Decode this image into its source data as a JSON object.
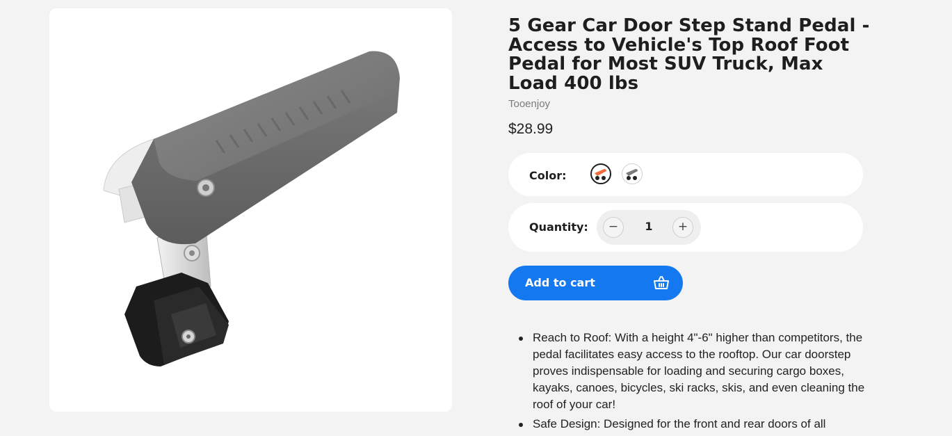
{
  "product": {
    "title": "5 Gear Car Door Step Stand Pedal - Access to Vehicle's Top Roof Foot Pedal for Most SUV Truck, Max Load 400 lbs",
    "image_alt": "Car door step pedal",
    "vendor": "Tooenjoy",
    "price": "$28.99"
  },
  "color_option": {
    "label": "Color:",
    "swatches": [
      {
        "name": "orange",
        "color": "#f06a3a",
        "selected": true
      },
      {
        "name": "gray",
        "color": "#7a7a7a",
        "selected": false
      }
    ]
  },
  "quantity_option": {
    "label": "Quantity:",
    "value": "1",
    "minus": "−",
    "plus": "+"
  },
  "cart": {
    "add_label": "Add to cart",
    "icon": "basket-icon",
    "color": "#1478f0"
  },
  "features": [
    "Reach to Roof: With a height 4\"-6\" higher than competitors, the pedal facilitates easy access to the rooftop. Our car doorstep proves indispensable for loading and securing cargo boxes, kayaks, canoes, bicycles, ski racks, skis, and even cleaning the roof of your car!",
    "Safe Design: Designed for the front and rear doors of all"
  ]
}
